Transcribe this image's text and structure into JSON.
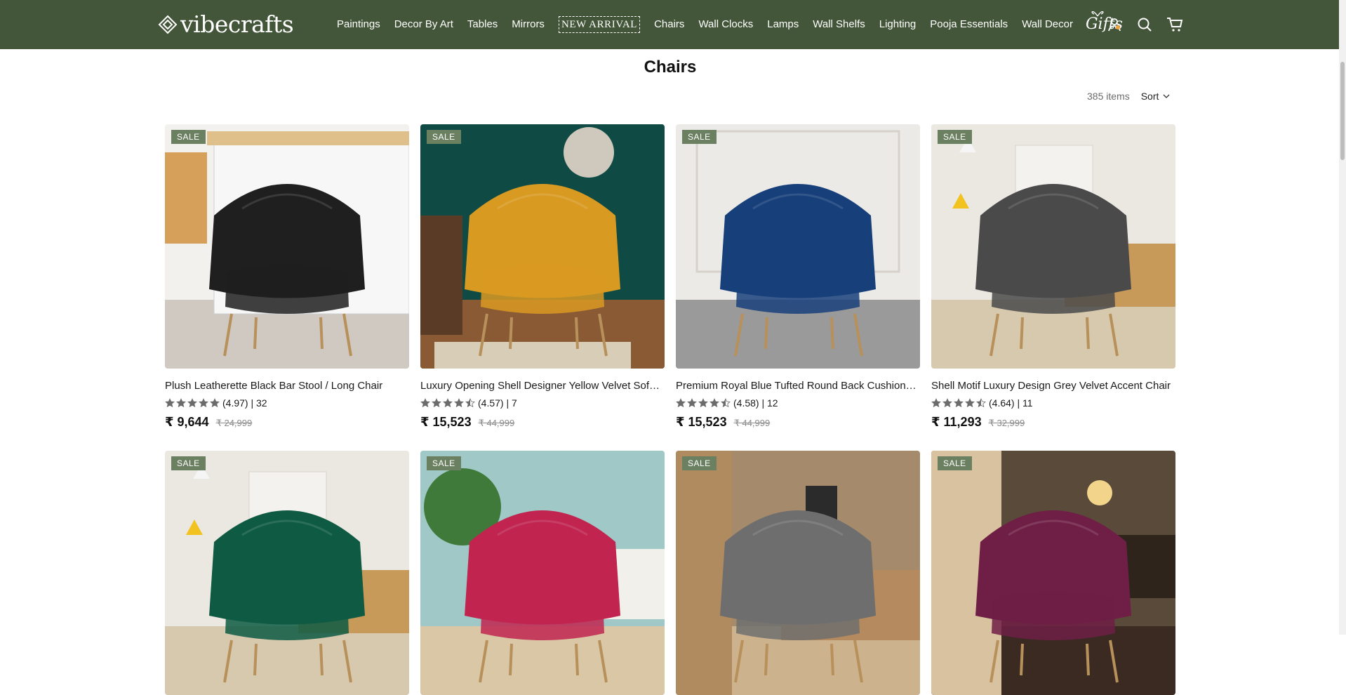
{
  "brand": {
    "name": "vibecrafts",
    "header_color": "#435639"
  },
  "nav": {
    "items": [
      "Paintings",
      "Decor By Art",
      "Tables",
      "Mirrors",
      "NEW ARRIVAL",
      "Chairs",
      "Wall Clocks",
      "Lamps",
      "Wall Shelfs",
      "Lighting",
      "Pooja Essentials",
      "Wall Decor"
    ],
    "gifts_label": "Gifts"
  },
  "header_icons": [
    "account-icon",
    "search-icon",
    "cart-icon"
  ],
  "page": {
    "title": "Chairs"
  },
  "toolbar": {
    "item_count": "385 items",
    "sort_label": "Sort"
  },
  "badge_label": "SALE",
  "products": [
    {
      "title": "Plush Leatherette Black Bar Stool / Long Chair",
      "rating": 4.97,
      "rating_text": "(4.97) | 32",
      "price": "₹ 9,644",
      "compare_price": "₹ 24,999",
      "chair_color": "#1f1f1f"
    },
    {
      "title": "Luxury Opening Shell Designer Yellow Velvet Sofa L...",
      "rating": 4.57,
      "rating_text": "(4.57) | 7",
      "price": "₹ 15,523",
      "compare_price": "₹ 44,999",
      "chair_color": "#d99a22"
    },
    {
      "title": "Premium Royal Blue Tufted Round Back Cushiony S...",
      "rating": 4.58,
      "rating_text": "(4.58) | 12",
      "price": "₹ 15,523",
      "compare_price": "₹ 44,999",
      "chair_color": "#173f7a"
    },
    {
      "title": "Shell Motif Luxury Design Grey Velvet Accent Chair",
      "rating": 4.64,
      "rating_text": "(4.64) | 11",
      "price": "₹ 11,293",
      "compare_price": "₹ 32,999",
      "chair_color": "#4a4a4a"
    },
    {
      "title": "",
      "chair_color": "#0e5a43"
    },
    {
      "title": "",
      "chair_color": "#c0244f"
    },
    {
      "title": "",
      "chair_color": "#6e6e6e"
    },
    {
      "title": "",
      "chair_color": "#6f1f45"
    }
  ]
}
